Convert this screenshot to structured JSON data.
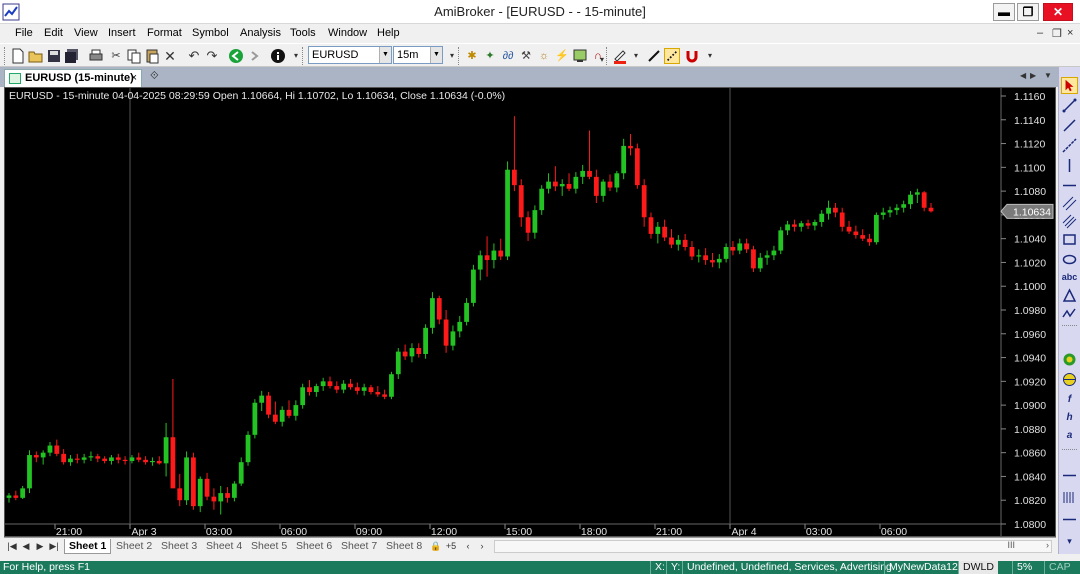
{
  "window": {
    "title": "AmiBroker - [EURUSD -  - 15-minute]",
    "minimize": "▬",
    "restore": "❐",
    "close": "✕"
  },
  "menu": {
    "items": [
      "File",
      "Edit",
      "View",
      "Insert",
      "Format",
      "Symbol",
      "Analysis",
      "Tools",
      "Window",
      "Help"
    ],
    "mdi_min": "–",
    "mdi_restore": "❐",
    "mdi_close": "×"
  },
  "toolbar": {
    "symbol_value": "EURUSD",
    "interval_value": "15m"
  },
  "doc_tab": {
    "label": "EURUSD (15-minute)",
    "close": "×",
    "float_icon": "⟐"
  },
  "chart_header": {
    "caption": "EURUSD - 15-minute 04-04-2025 08:29:59 Open 1.10664, Hi 1.10702, Lo 1.10634, Close 1.10634 (-0.0%)"
  },
  "chart_data": {
    "type": "candlestick",
    "symbol": "EURUSD",
    "interval": "15-minute",
    "y_ticks": [
      "1.1160",
      "1.1140",
      "1.1120",
      "1.1100",
      "1.1080",
      "1.1060",
      "1.1040",
      "1.1020",
      "1.1000",
      "1.0980",
      "1.0960",
      "1.0940",
      "1.0920",
      "1.0900",
      "1.0880",
      "1.0860",
      "1.0840",
      "1.0820",
      "1.0800"
    ],
    "ylim": [
      1.08,
      1.116
    ],
    "x_ticks": [
      "21:00",
      "Apr 3",
      "03:00",
      "06:00",
      "09:00",
      "12:00",
      "15:00",
      "18:00",
      "21:00",
      "Apr 4",
      "03:00",
      "06:00"
    ],
    "last_price_label": "1.10634",
    "up_color": "#22c322",
    "down_color": "#ff1a1a",
    "background": "#000000",
    "candles": [
      {
        "o": 1.0822,
        "h": 1.0826,
        "l": 1.0818,
        "c": 1.0824
      },
      {
        "o": 1.0824,
        "h": 1.0828,
        "l": 1.082,
        "c": 1.0822
      },
      {
        "o": 1.0822,
        "h": 1.0832,
        "l": 1.0821,
        "c": 1.083
      },
      {
        "o": 1.083,
        "h": 1.0862,
        "l": 1.0826,
        "c": 1.0858
      },
      {
        "o": 1.0858,
        "h": 1.0861,
        "l": 1.0852,
        "c": 1.0856
      },
      {
        "o": 1.0856,
        "h": 1.0862,
        "l": 1.085,
        "c": 1.086
      },
      {
        "o": 1.086,
        "h": 1.0869,
        "l": 1.0857,
        "c": 1.0866
      },
      {
        "o": 1.0866,
        "h": 1.0871,
        "l": 1.0857,
        "c": 1.0859
      },
      {
        "o": 1.0859,
        "h": 1.0863,
        "l": 1.085,
        "c": 1.0852
      },
      {
        "o": 1.0852,
        "h": 1.0858,
        "l": 1.0849,
        "c": 1.0855
      },
      {
        "o": 1.0855,
        "h": 1.0859,
        "l": 1.0851,
        "c": 1.0854
      },
      {
        "o": 1.0854,
        "h": 1.0859,
        "l": 1.0851,
        "c": 1.0856
      },
      {
        "o": 1.0856,
        "h": 1.0861,
        "l": 1.0853,
        "c": 1.0857
      },
      {
        "o": 1.0857,
        "h": 1.0859,
        "l": 1.0852,
        "c": 1.0855
      },
      {
        "o": 1.0855,
        "h": 1.0857,
        "l": 1.0851,
        "c": 1.0853
      },
      {
        "o": 1.0853,
        "h": 1.0858,
        "l": 1.085,
        "c": 1.0856
      },
      {
        "o": 1.0856,
        "h": 1.0859,
        "l": 1.0851,
        "c": 1.0854
      },
      {
        "o": 1.0854,
        "h": 1.0857,
        "l": 1.085,
        "c": 1.0853
      },
      {
        "o": 1.0853,
        "h": 1.0858,
        "l": 1.0851,
        "c": 1.0856
      },
      {
        "o": 1.0856,
        "h": 1.086,
        "l": 1.0852,
        "c": 1.0854
      },
      {
        "o": 1.0854,
        "h": 1.0857,
        "l": 1.085,
        "c": 1.0852
      },
      {
        "o": 1.0852,
        "h": 1.0856,
        "l": 1.0849,
        "c": 1.0853
      },
      {
        "o": 1.0853,
        "h": 1.0857,
        "l": 1.085,
        "c": 1.0851
      },
      {
        "o": 1.0851,
        "h": 1.0885,
        "l": 1.084,
        "c": 1.0873
      },
      {
        "o": 1.0873,
        "h": 1.0922,
        "l": 1.084,
        "c": 1.083
      },
      {
        "o": 1.083,
        "h": 1.0842,
        "l": 1.0815,
        "c": 1.082
      },
      {
        "o": 1.082,
        "h": 1.0861,
        "l": 1.0816,
        "c": 1.0856
      },
      {
        "o": 1.0856,
        "h": 1.086,
        "l": 1.0812,
        "c": 1.0815
      },
      {
        "o": 1.0815,
        "h": 1.084,
        "l": 1.081,
        "c": 1.0838
      },
      {
        "o": 1.0838,
        "h": 1.0843,
        "l": 1.082,
        "c": 1.0823
      },
      {
        "o": 1.0823,
        "h": 1.083,
        "l": 1.0812,
        "c": 1.0819
      },
      {
        "o": 1.0819,
        "h": 1.0832,
        "l": 1.0808,
        "c": 1.0826
      },
      {
        "o": 1.0826,
        "h": 1.0831,
        "l": 1.0818,
        "c": 1.0822
      },
      {
        "o": 1.0822,
        "h": 1.0836,
        "l": 1.0819,
        "c": 1.0834
      },
      {
        "o": 1.0834,
        "h": 1.0856,
        "l": 1.0832,
        "c": 1.0852
      },
      {
        "o": 1.0852,
        "h": 1.0878,
        "l": 1.0849,
        "c": 1.0875
      },
      {
        "o": 1.0875,
        "h": 1.0905,
        "l": 1.0872,
        "c": 1.0902
      },
      {
        "o": 1.0902,
        "h": 1.0912,
        "l": 1.0895,
        "c": 1.0908
      },
      {
        "o": 1.0908,
        "h": 1.0911,
        "l": 1.0889,
        "c": 1.0892
      },
      {
        "o": 1.0892,
        "h": 1.0903,
        "l": 1.0884,
        "c": 1.0886
      },
      {
        "o": 1.0886,
        "h": 1.0899,
        "l": 1.0882,
        "c": 1.0896
      },
      {
        "o": 1.0896,
        "h": 1.0904,
        "l": 1.0889,
        "c": 1.0891
      },
      {
        "o": 1.0891,
        "h": 1.0904,
        "l": 1.0887,
        "c": 1.09
      },
      {
        "o": 1.09,
        "h": 1.0918,
        "l": 1.0897,
        "c": 1.0915
      },
      {
        "o": 1.0915,
        "h": 1.0921,
        "l": 1.0908,
        "c": 1.0911
      },
      {
        "o": 1.0911,
        "h": 1.0918,
        "l": 1.0907,
        "c": 1.0916
      },
      {
        "o": 1.0916,
        "h": 1.0923,
        "l": 1.0912,
        "c": 1.092
      },
      {
        "o": 1.092,
        "h": 1.0924,
        "l": 1.0914,
        "c": 1.0916
      },
      {
        "o": 1.0916,
        "h": 1.092,
        "l": 1.091,
        "c": 1.0913
      },
      {
        "o": 1.0913,
        "h": 1.0921,
        "l": 1.091,
        "c": 1.0918
      },
      {
        "o": 1.0918,
        "h": 1.0922,
        "l": 1.0913,
        "c": 1.0915
      },
      {
        "o": 1.0915,
        "h": 1.0919,
        "l": 1.0909,
        "c": 1.0912
      },
      {
        "o": 1.0912,
        "h": 1.0918,
        "l": 1.0908,
        "c": 1.0915
      },
      {
        "o": 1.0915,
        "h": 1.0917,
        "l": 1.0909,
        "c": 1.0911
      },
      {
        "o": 1.0911,
        "h": 1.0916,
        "l": 1.0907,
        "c": 1.0909
      },
      {
        "o": 1.0909,
        "h": 1.0913,
        "l": 1.0905,
        "c": 1.0907
      },
      {
        "o": 1.0907,
        "h": 1.0928,
        "l": 1.0905,
        "c": 1.0926
      },
      {
        "o": 1.0926,
        "h": 1.0948,
        "l": 1.0922,
        "c": 1.0945
      },
      {
        "o": 1.0945,
        "h": 1.0951,
        "l": 1.0938,
        "c": 1.0941
      },
      {
        "o": 1.0941,
        "h": 1.0952,
        "l": 1.0936,
        "c": 1.0948
      },
      {
        "o": 1.0948,
        "h": 1.0952,
        "l": 1.094,
        "c": 1.0943
      },
      {
        "o": 1.0943,
        "h": 1.0968,
        "l": 1.0939,
        "c": 1.0965
      },
      {
        "o": 1.0965,
        "h": 1.0995,
        "l": 1.096,
        "c": 1.099
      },
      {
        "o": 1.099,
        "h": 1.0992,
        "l": 1.0968,
        "c": 1.0972
      },
      {
        "o": 1.0972,
        "h": 1.098,
        "l": 1.0944,
        "c": 1.095
      },
      {
        "o": 1.095,
        "h": 1.0967,
        "l": 1.0946,
        "c": 1.0962
      },
      {
        "o": 1.0962,
        "h": 1.0975,
        "l": 1.0957,
        "c": 1.097
      },
      {
        "o": 1.097,
        "h": 1.099,
        "l": 1.0967,
        "c": 1.0986
      },
      {
        "o": 1.0986,
        "h": 1.1018,
        "l": 1.0983,
        "c": 1.1014
      },
      {
        "o": 1.1014,
        "h": 1.103,
        "l": 1.1005,
        "c": 1.1026
      },
      {
        "o": 1.1026,
        "h": 1.1042,
        "l": 1.1008,
        "c": 1.1022
      },
      {
        "o": 1.1022,
        "h": 1.1036,
        "l": 1.1015,
        "c": 1.103
      },
      {
        "o": 1.103,
        "h": 1.104,
        "l": 1.1022,
        "c": 1.1025
      },
      {
        "o": 1.1025,
        "h": 1.1105,
        "l": 1.1022,
        "c": 1.1098
      },
      {
        "o": 1.1098,
        "h": 1.1143,
        "l": 1.108,
        "c": 1.1085
      },
      {
        "o": 1.1085,
        "h": 1.109,
        "l": 1.105,
        "c": 1.1058
      },
      {
        "o": 1.1058,
        "h": 1.1063,
        "l": 1.1038,
        "c": 1.1045
      },
      {
        "o": 1.1045,
        "h": 1.1068,
        "l": 1.104,
        "c": 1.1064
      },
      {
        "o": 1.1064,
        "h": 1.1085,
        "l": 1.106,
        "c": 1.1082
      },
      {
        "o": 1.1082,
        "h": 1.1095,
        "l": 1.1078,
        "c": 1.1088
      },
      {
        "o": 1.1088,
        "h": 1.1101,
        "l": 1.108,
        "c": 1.1084
      },
      {
        "o": 1.1084,
        "h": 1.109,
        "l": 1.1076,
        "c": 1.1086
      },
      {
        "o": 1.1086,
        "h": 1.1095,
        "l": 1.108,
        "c": 1.1082
      },
      {
        "o": 1.1082,
        "h": 1.1096,
        "l": 1.1078,
        "c": 1.1092
      },
      {
        "o": 1.1092,
        "h": 1.1102,
        "l": 1.1086,
        "c": 1.1097
      },
      {
        "o": 1.1097,
        "h": 1.1131,
        "l": 1.109,
        "c": 1.1092
      },
      {
        "o": 1.1092,
        "h": 1.1098,
        "l": 1.107,
        "c": 1.1076
      },
      {
        "o": 1.1076,
        "h": 1.109,
        "l": 1.1071,
        "c": 1.1088
      },
      {
        "o": 1.1088,
        "h": 1.1094,
        "l": 1.108,
        "c": 1.1083
      },
      {
        "o": 1.1083,
        "h": 1.1097,
        "l": 1.1079,
        "c": 1.1095
      },
      {
        "o": 1.1095,
        "h": 1.1124,
        "l": 1.109,
        "c": 1.1118
      },
      {
        "o": 1.1118,
        "h": 1.1128,
        "l": 1.111,
        "c": 1.1116
      },
      {
        "o": 1.1116,
        "h": 1.112,
        "l": 1.1082,
        "c": 1.1085
      },
      {
        "o": 1.1085,
        "h": 1.109,
        "l": 1.105,
        "c": 1.1058
      },
      {
        "o": 1.1058,
        "h": 1.1062,
        "l": 1.104,
        "c": 1.1044
      },
      {
        "o": 1.1044,
        "h": 1.1054,
        "l": 1.1036,
        "c": 1.105
      },
      {
        "o": 1.105,
        "h": 1.1056,
        "l": 1.1038,
        "c": 1.1041
      },
      {
        "o": 1.1041,
        "h": 1.1048,
        "l": 1.1032,
        "c": 1.1035
      },
      {
        "o": 1.1035,
        "h": 1.1043,
        "l": 1.103,
        "c": 1.1039
      },
      {
        "o": 1.1039,
        "h": 1.1044,
        "l": 1.103,
        "c": 1.1033
      },
      {
        "o": 1.1033,
        "h": 1.1038,
        "l": 1.1022,
        "c": 1.1025
      },
      {
        "o": 1.1025,
        "h": 1.1031,
        "l": 1.102,
        "c": 1.1026
      },
      {
        "o": 1.1026,
        "h": 1.1032,
        "l": 1.1018,
        "c": 1.1022
      },
      {
        "o": 1.1022,
        "h": 1.1028,
        "l": 1.1016,
        "c": 1.102
      },
      {
        "o": 1.102,
        "h": 1.1027,
        "l": 1.1015,
        "c": 1.1023
      },
      {
        "o": 1.1023,
        "h": 1.1036,
        "l": 1.102,
        "c": 1.1033
      },
      {
        "o": 1.1033,
        "h": 1.1038,
        "l": 1.1026,
        "c": 1.103
      },
      {
        "o": 1.103,
        "h": 1.104,
        "l": 1.1027,
        "c": 1.1036
      },
      {
        "o": 1.1036,
        "h": 1.104,
        "l": 1.1028,
        "c": 1.1031
      },
      {
        "o": 1.1031,
        "h": 1.1034,
        "l": 1.1012,
        "c": 1.1015
      },
      {
        "o": 1.1015,
        "h": 1.1028,
        "l": 1.1012,
        "c": 1.1024
      },
      {
        "o": 1.1024,
        "h": 1.103,
        "l": 1.1018,
        "c": 1.1026
      },
      {
        "o": 1.1026,
        "h": 1.1034,
        "l": 1.1022,
        "c": 1.103
      },
      {
        "o": 1.103,
        "h": 1.105,
        "l": 1.1027,
        "c": 1.1047
      },
      {
        "o": 1.1047,
        "h": 1.1055,
        "l": 1.1043,
        "c": 1.1052
      },
      {
        "o": 1.1052,
        "h": 1.1056,
        "l": 1.1046,
        "c": 1.105
      },
      {
        "o": 1.105,
        "h": 1.1055,
        "l": 1.1046,
        "c": 1.1053
      },
      {
        "o": 1.1053,
        "h": 1.1056,
        "l": 1.1048,
        "c": 1.1051
      },
      {
        "o": 1.1051,
        "h": 1.1056,
        "l": 1.1047,
        "c": 1.1054
      },
      {
        "o": 1.1054,
        "h": 1.1064,
        "l": 1.105,
        "c": 1.1061
      },
      {
        "o": 1.1061,
        "h": 1.1072,
        "l": 1.1056,
        "c": 1.1066
      },
      {
        "o": 1.1066,
        "h": 1.107,
        "l": 1.1058,
        "c": 1.1062
      },
      {
        "o": 1.1062,
        "h": 1.1066,
        "l": 1.1046,
        "c": 1.105
      },
      {
        "o": 1.105,
        "h": 1.1055,
        "l": 1.1044,
        "c": 1.1046
      },
      {
        "o": 1.1046,
        "h": 1.1051,
        "l": 1.104,
        "c": 1.1043
      },
      {
        "o": 1.1043,
        "h": 1.1048,
        "l": 1.1038,
        "c": 1.104
      },
      {
        "o": 1.104,
        "h": 1.1044,
        "l": 1.1034,
        "c": 1.1037
      },
      {
        "o": 1.1037,
        "h": 1.1062,
        "l": 1.1035,
        "c": 1.106
      },
      {
        "o": 1.106,
        "h": 1.1066,
        "l": 1.1056,
        "c": 1.1062
      },
      {
        "o": 1.1062,
        "h": 1.1067,
        "l": 1.1058,
        "c": 1.1064
      },
      {
        "o": 1.1064,
        "h": 1.1069,
        "l": 1.106,
        "c": 1.1066
      },
      {
        "o": 1.1066,
        "h": 1.1072,
        "l": 1.1062,
        "c": 1.1069
      },
      {
        "o": 1.1069,
        "h": 1.108,
        "l": 1.1065,
        "c": 1.1077
      },
      {
        "o": 1.1077,
        "h": 1.1082,
        "l": 1.107,
        "c": 1.1079
      },
      {
        "o": 1.1079,
        "h": 1.108,
        "l": 1.1063,
        "c": 1.1066
      },
      {
        "o": 1.1066,
        "h": 1.107,
        "l": 1.1062,
        "c": 1.1063
      }
    ]
  },
  "sheets": {
    "tabs": [
      "Sheet 1",
      "Sheet 2",
      "Sheet 3",
      "Sheet 4",
      "Sheet 5",
      "Sheet 6",
      "Sheet 7",
      "Sheet 8"
    ],
    "lock": "🔒",
    "extra": "+5",
    "scroll_left": "‹",
    "scroll_right": "›"
  },
  "status": {
    "help": "For Help, press F1",
    "x": "X:",
    "y": "Y:",
    "category": "Undefined, Undefined, Services, Advertising",
    "db": "MyNewData12",
    "dwld": "DWLD",
    "pct": "5%",
    "cap": "CAP"
  }
}
